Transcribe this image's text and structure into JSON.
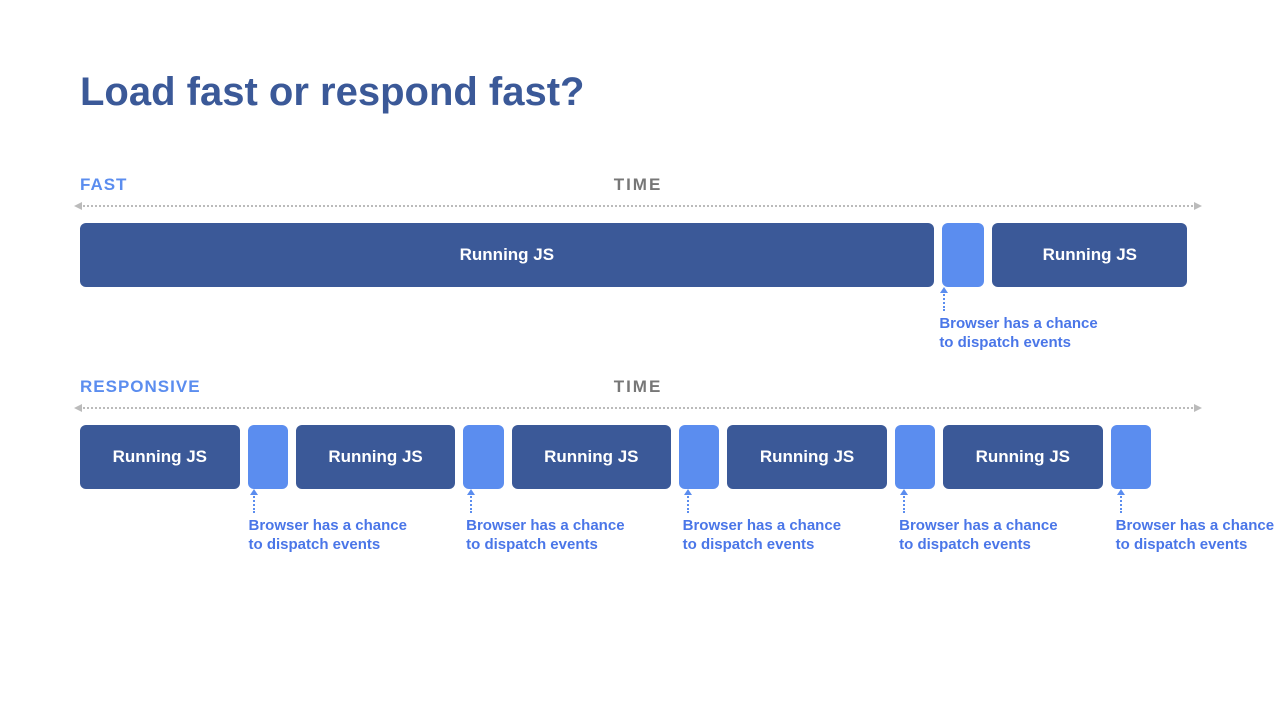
{
  "title": "Load fast or respond fast?",
  "time_label": "TIME",
  "annotation_text": "Browser has a chance to dispatch events",
  "fast": {
    "label": "FAST",
    "blocks": [
      {
        "kind": "js",
        "label": "Running JS",
        "width_pct": 76.5
      },
      {
        "kind": "gap",
        "label": "",
        "width_pct": 3.8
      },
      {
        "kind": "js",
        "label": "Running JS",
        "width_pct": 17.5
      }
    ],
    "annotations_left_pct": [
      77.0
    ]
  },
  "responsive": {
    "label": "RESPONSIVE",
    "blocks": [
      {
        "kind": "js",
        "label": "Running JS",
        "width_pct": 14.3
      },
      {
        "kind": "gap",
        "label": "",
        "width_pct": 3.6
      },
      {
        "kind": "js",
        "label": "Running JS",
        "width_pct": 14.3
      },
      {
        "kind": "gap",
        "label": "",
        "width_pct": 3.6
      },
      {
        "kind": "js",
        "label": "Running JS",
        "width_pct": 14.3
      },
      {
        "kind": "gap",
        "label": "",
        "width_pct": 3.6
      },
      {
        "kind": "js",
        "label": "Running JS",
        "width_pct": 14.3
      },
      {
        "kind": "gap",
        "label": "",
        "width_pct": 3.6
      },
      {
        "kind": "js",
        "label": "Running JS",
        "width_pct": 14.3
      },
      {
        "kind": "gap",
        "label": "",
        "width_pct": 3.6
      }
    ],
    "annotations_left_pct": [
      15.1,
      34.6,
      54.0,
      73.4,
      92.8
    ]
  },
  "colors": {
    "title": "#3b5998",
    "js_block": "#3b5998",
    "gap_block": "#5b8def",
    "accent_text": "#4a76e8",
    "time_label": "#777777"
  }
}
